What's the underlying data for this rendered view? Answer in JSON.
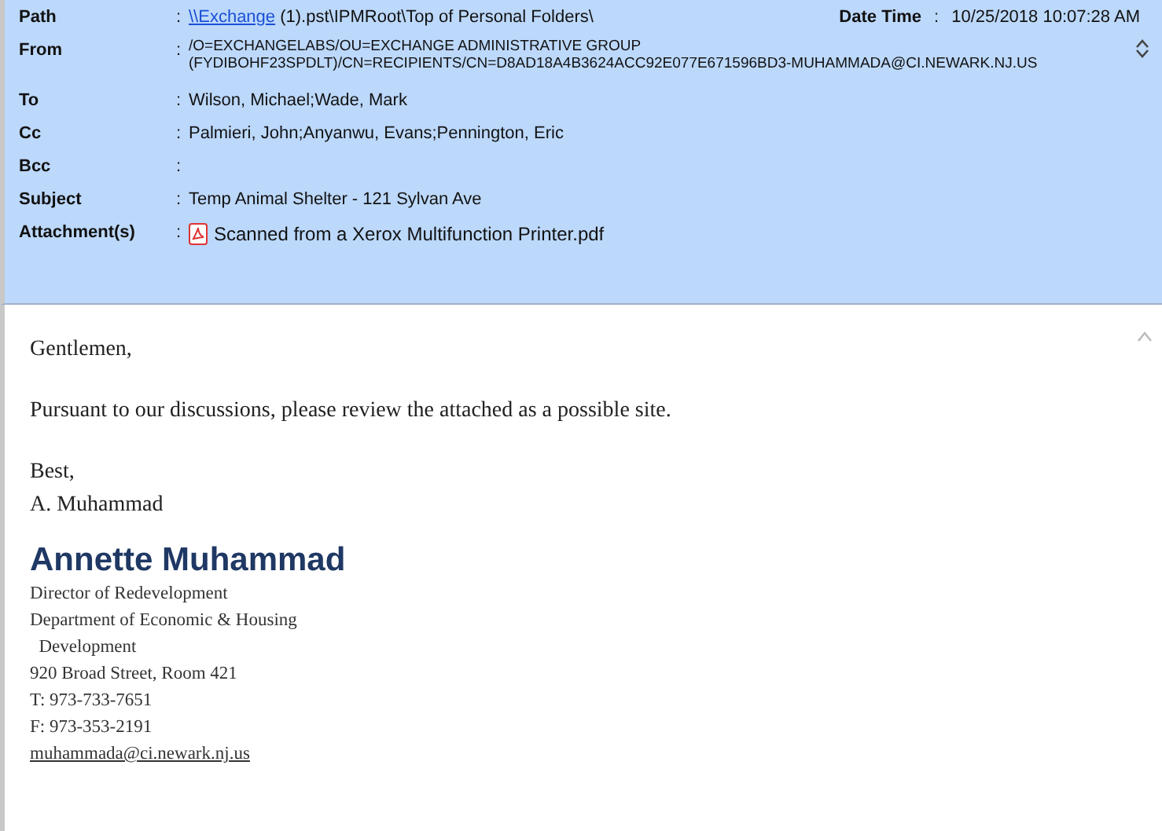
{
  "header": {
    "fields": [
      {
        "label": "Path",
        "separator": ":",
        "kind": "path",
        "link": "\\\\Exchange",
        "value": " (1).pst\\IPMRoot\\Top of Personal Folders\\"
      },
      {
        "label": "From",
        "separator": ":",
        "kind": "multiline",
        "lines": [
          "/O=EXCHANGELABS/OU=EXCHANGE ADMINISTRATIVE GROUP",
          "(FYDIBOHF23SPDLT)/CN=RECIPIENTS/CN=D8AD18A4B3624ACC92E077E671596BD3-MUHAMMADA@CI.NEWARK.NJ.US"
        ]
      },
      {
        "label": "To",
        "separator": ":",
        "kind": "text",
        "value": "Wilson, Michael;Wade, Mark"
      },
      {
        "label": "Cc",
        "separator": ":",
        "kind": "text",
        "value": "Palmieri, John;Anyanwu, Evans;Pennington, Eric"
      },
      {
        "label": "Bcc",
        "separator": ":",
        "kind": "text"
      },
      {
        "label": "Subject",
        "separator": ":",
        "kind": "text",
        "value": "Temp Animal Shelter - 121 Sylvan Ave"
      },
      {
        "label": "Attachment(s)",
        "separator": ":",
        "kind": "attachment",
        "value": "Scanned from a Xerox Multifunction Printer.pdf"
      }
    ],
    "date_label": "Date Time",
    "date_separator": ":",
    "date_value": "10/25/2018 10:07:28 AM"
  },
  "body": {
    "paragraphs": [
      [
        "Gentlemen,"
      ],
      [
        "Pursuant to our discussions, please review the attached as a possible site."
      ],
      [
        "Best,",
        "A. Muhammad"
      ]
    ],
    "signature": {
      "name": "Annette Muhammad",
      "lines": [
        "Director of Redevelopment",
        "Department of Economic & Housing",
        "  Development",
        "920 Broad Street, Room 421",
        "T: 973-733-7651",
        "F: 973-353-2191"
      ],
      "email": "muhammada@ci.newark.nj.us"
    }
  }
}
